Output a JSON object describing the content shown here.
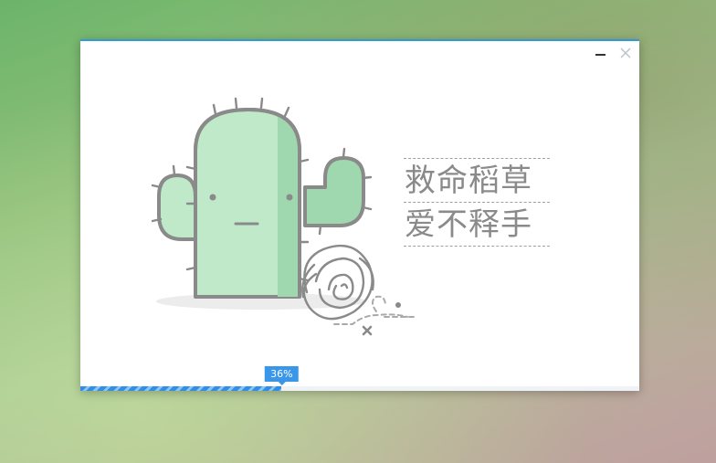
{
  "window": {
    "minimize_icon": "minimize-icon",
    "close_icon": "close-icon",
    "accent_color": "#2f9ad8"
  },
  "slogan": {
    "line1": "救命稻草",
    "line2": "爱不释手"
  },
  "progress": {
    "percent": 36,
    "label": "36%",
    "color": "#3a96e8"
  },
  "illustration": {
    "icon": "cactus-icon",
    "cactus_color": "#bfe9c9",
    "outline_color": "#8a8a8a"
  }
}
